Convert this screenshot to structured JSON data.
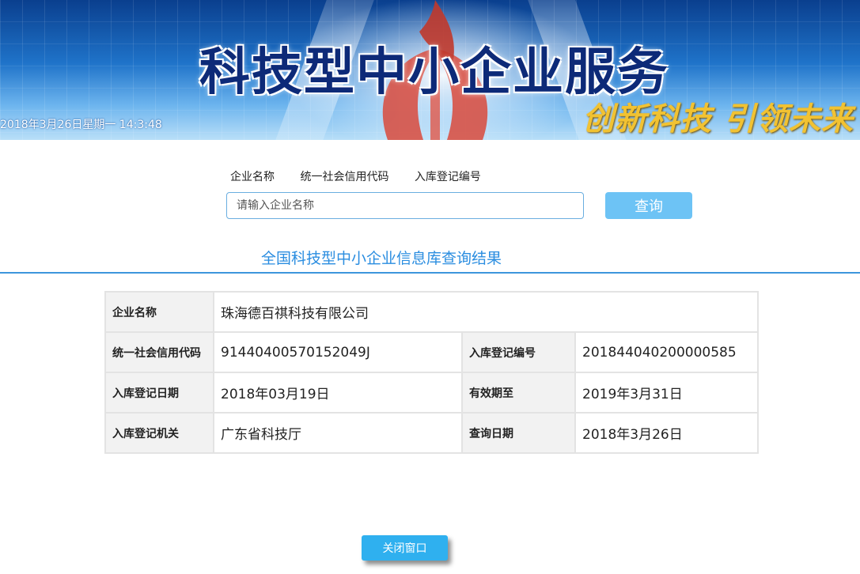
{
  "banner": {
    "title": "科技型中小企业服务",
    "slogan": "创新科技  引领未来",
    "datetime": "2018年3月26日星期一 14:3:48"
  },
  "search": {
    "tabs": [
      "企业名称",
      "统一社会信用代码",
      "入库登记编号"
    ],
    "placeholder": "请输入企业名称",
    "button_label": "查询"
  },
  "result_title": "全国科技型中小企业信息库查询结果",
  "details": {
    "company_name_label": "企业名称",
    "company_name": "珠海德百祺科技有限公司",
    "credit_code_label": "统一社会信用代码",
    "credit_code": "91440400570152049J",
    "registration_no_label": "入库登记编号",
    "registration_no": "201844040200000585",
    "registration_date_label": "入库登记日期",
    "registration_date": "2018年03月19日",
    "valid_until_label": "有效期至",
    "valid_until": "2019年3月31日",
    "registration_authority_label": "入库登记机关",
    "registration_authority": "广东省科技厅",
    "query_date_label": "查询日期",
    "query_date": "2018年3月26日"
  },
  "close_button_label": "关闭窗口",
  "colors": {
    "accent": "#2a8de0",
    "search_button": "#6dc3f5",
    "close_button": "#2fb0ef",
    "title_text": "#0d2a78",
    "slogan": "#f1c232"
  }
}
